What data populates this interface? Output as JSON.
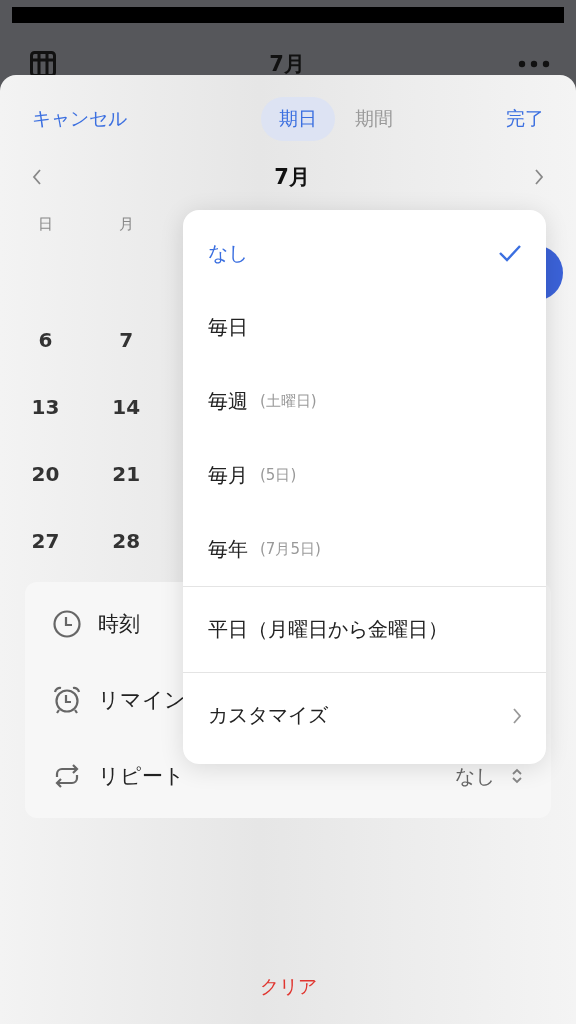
{
  "background_header": {
    "title": "7月"
  },
  "sheet": {
    "cancel": "キャンセル",
    "done": "完了",
    "tabs": [
      {
        "label": "期日",
        "selected": true
      },
      {
        "label": "期間",
        "selected": false
      }
    ],
    "month": "7月",
    "weekdays": [
      "日",
      "月"
    ],
    "weeks": [
      [
        "6",
        "7"
      ],
      [
        "13",
        "14"
      ],
      [
        "20",
        "21"
      ],
      [
        "27",
        "28"
      ]
    ],
    "settings": [
      {
        "kind": "time",
        "label": "時刻"
      },
      {
        "kind": "reminder",
        "label": "リマイン"
      },
      {
        "kind": "repeat",
        "label": "リピート",
        "value": "なし"
      }
    ],
    "clear": "クリア"
  },
  "repeat_menu": [
    {
      "kind": "option",
      "label": "なし",
      "selected": true
    },
    {
      "kind": "option",
      "label": "毎日",
      "selected": false
    },
    {
      "kind": "option",
      "label": "毎週",
      "detail": "(土曜日)",
      "selected": false
    },
    {
      "kind": "option",
      "label": "毎月",
      "detail": "(5日)",
      "selected": false
    },
    {
      "kind": "option",
      "label": "毎年",
      "detail": "(7月5日)",
      "selected": false
    },
    {
      "kind": "option",
      "label": "平日（月曜日から金曜日）",
      "divider_before": true,
      "selected": false
    },
    {
      "kind": "submenu",
      "label": "カスタマイズ",
      "divider_before": true,
      "selected": false
    }
  ]
}
